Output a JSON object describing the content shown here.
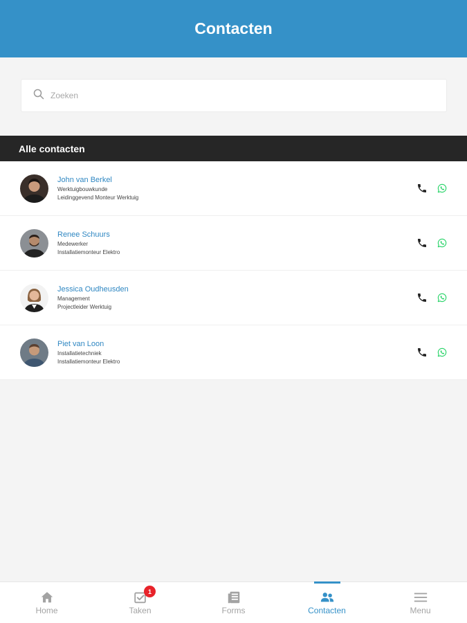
{
  "header": {
    "title": "Contacten"
  },
  "search": {
    "placeholder": "Zoeken",
    "icon": "search-icon"
  },
  "section": {
    "title": "Alle contacten"
  },
  "contacts": [
    {
      "name": "John van Berkel",
      "role": "Werktuigbouwkunde",
      "function": "Leidinggevend Monteur Werktuig"
    },
    {
      "name": "Renee Schuurs",
      "role": "Medewerker",
      "function": "Installatiemonteur Elektro"
    },
    {
      "name": "Jessica Oudheusden",
      "role": "Management",
      "function": "Projectleider Werktuig"
    },
    {
      "name": "Piet van Loon",
      "role": "Installatietechniek",
      "function": "Installatiemonteur Elektro"
    }
  ],
  "tabbar": {
    "items": [
      {
        "label": "Home",
        "icon": "home-icon"
      },
      {
        "label": "Taken",
        "icon": "tasks-icon",
        "badge": "1"
      },
      {
        "label": "Forms",
        "icon": "forms-icon"
      },
      {
        "label": "Contacten",
        "icon": "contacts-icon"
      },
      {
        "label": "Menu",
        "icon": "menu-icon"
      }
    ],
    "active": "Contacten"
  },
  "colors": {
    "primary": "#3591c8",
    "section_bar": "#262626",
    "whatsapp": "#25d366",
    "badge": "#e8232a"
  }
}
